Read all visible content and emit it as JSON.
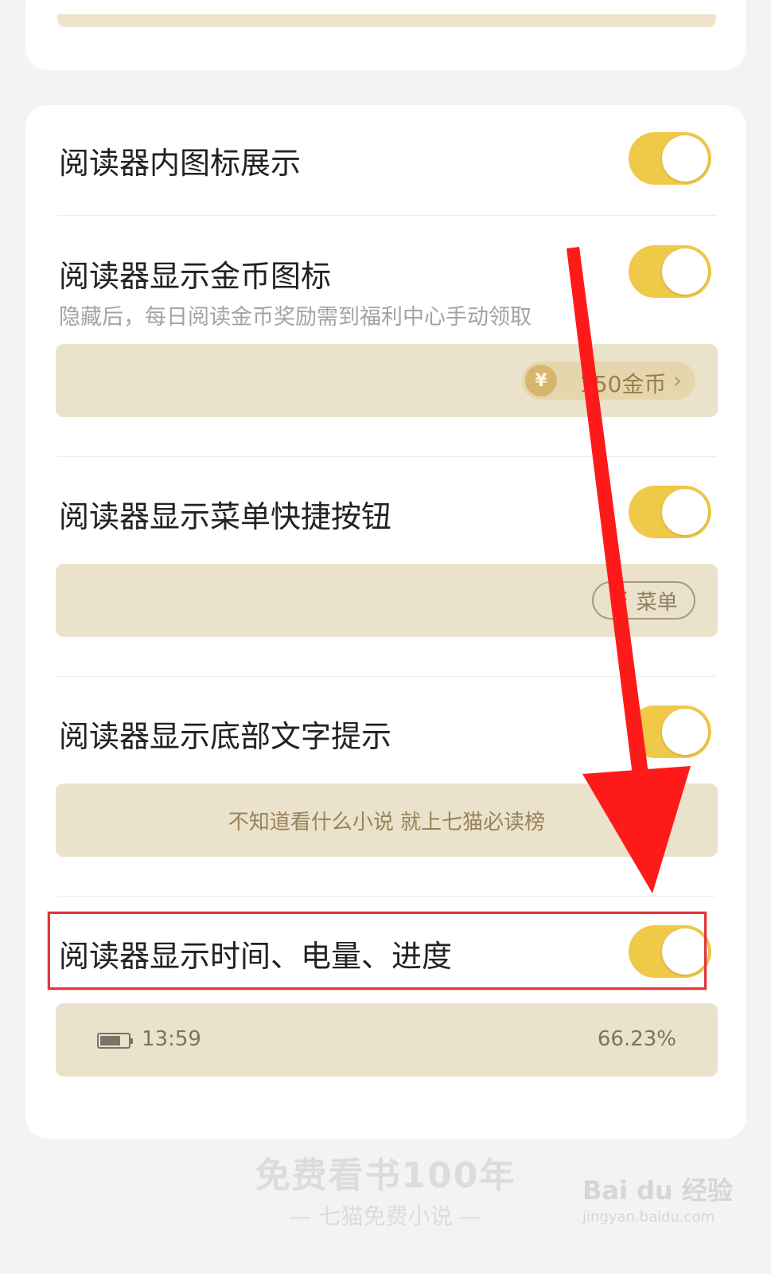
{
  "settings": [
    {
      "title": "阅读器内图标展示",
      "enabled": true
    },
    {
      "title": "阅读器显示金币图标",
      "subtitle": "隐藏后，每日阅读金币奖励需到福利中心手动领取",
      "enabled": true,
      "preview": {
        "coin_symbol": "¥",
        "coin_text": "150金币",
        "chevron": "›"
      }
    },
    {
      "title": "阅读器显示菜单快捷按钮",
      "enabled": true,
      "preview": {
        "menu_icon": "☰",
        "menu_text": "菜单"
      }
    },
    {
      "title": "阅读器显示底部文字提示",
      "enabled": true,
      "preview": {
        "hint": "不知道看什么小说 就上七猫必读榜"
      }
    },
    {
      "title": "阅读器显示时间、电量、进度",
      "enabled": true,
      "preview": {
        "time": "13:59",
        "progress": "66.23%"
      }
    }
  ],
  "footer": {
    "slogan": "免费看书100年",
    "app": "— 七猫免费小说 —"
  },
  "watermark": {
    "brand": "Bai du 经验",
    "url": "jingyan.baidu.com"
  },
  "colors": {
    "toggle_on": "#f0c949",
    "highlight": "#e2363a",
    "arrow": "#ff1a1a"
  }
}
